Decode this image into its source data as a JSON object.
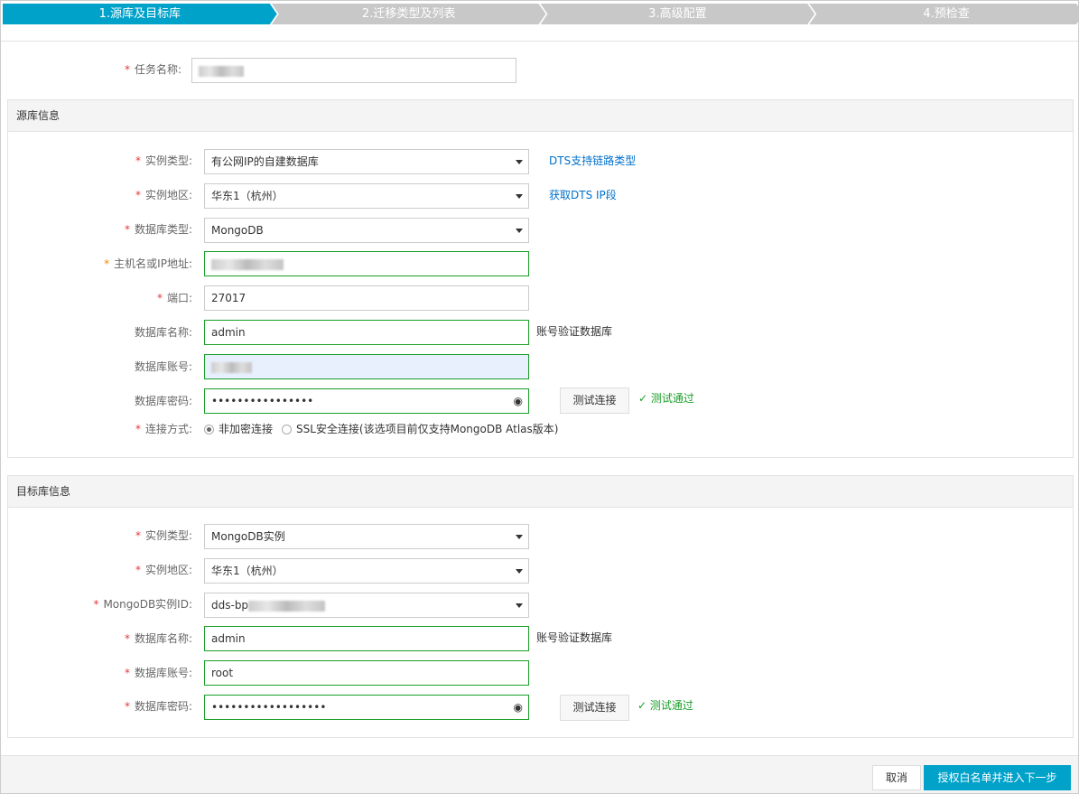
{
  "steps": [
    "1.源库及目标库",
    "2.迁移类型及列表",
    "3.高级配置",
    "4.预检查"
  ],
  "task": {
    "label": "任务名称:"
  },
  "source": {
    "title": "源库信息",
    "instance_type": {
      "label": "实例类型:",
      "value": "有公网IP的自建数据库",
      "link": "DTS支持链路类型"
    },
    "region": {
      "label": "实例地区:",
      "value": "华东1（杭州）",
      "link": "获取DTS IP段"
    },
    "db_type": {
      "label": "数据库类型:",
      "value": "MongoDB"
    },
    "host": {
      "label": "主机名或IP地址:"
    },
    "port": {
      "label": "端口:",
      "value": "27017"
    },
    "db_name": {
      "label": "数据库名称:",
      "value": "admin",
      "hint": "账号验证数据库"
    },
    "account": {
      "label": "数据库账号:"
    },
    "password": {
      "label": "数据库密码:",
      "value": "••••••••••••••••",
      "test": "测试连接",
      "status": "测试通过"
    },
    "conn": {
      "label": "连接方式:",
      "opt1": "非加密连接",
      "opt2": "SSL安全连接(该选项目前仅支持MongoDB Atlas版本)"
    }
  },
  "target": {
    "title": "目标库信息",
    "instance_type": {
      "label": "实例类型:",
      "value": "MongoDB实例"
    },
    "region": {
      "label": "实例地区:",
      "value": "华东1（杭州）"
    },
    "instance_id": {
      "label": "MongoDB实例ID:",
      "value": "dds-bp"
    },
    "db_name": {
      "label": "数据库名称:",
      "value": "admin",
      "hint": "账号验证数据库"
    },
    "account": {
      "label": "数据库账号:",
      "value": "root"
    },
    "password": {
      "label": "数据库密码:",
      "value": "••••••••••••••••••",
      "test": "测试连接",
      "status": "测试通过"
    }
  },
  "footer": {
    "cancel": "取消",
    "next": "授权白名单并进入下一步"
  },
  "req": "*",
  "colors": {
    "accent": "#00a2ca",
    "ok": "#1a9f29",
    "required": "#e4393c"
  }
}
